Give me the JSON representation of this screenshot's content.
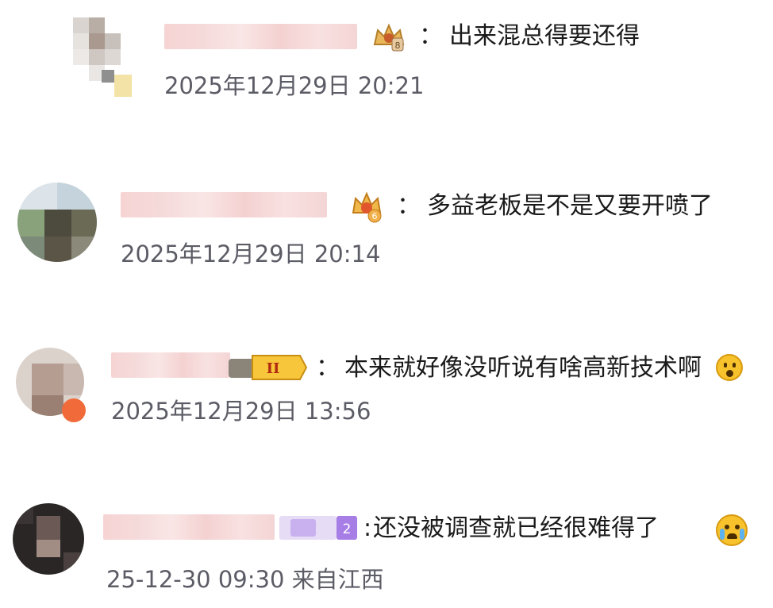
{
  "comments": [
    {
      "separator": "：",
      "text": "出来混总得要还得",
      "time": "2025年12月29日 20:21",
      "badge_level": "8"
    },
    {
      "separator": "：",
      "text": "多益老板是不是又要开喷了",
      "time": "2025年12月29日 20:14",
      "badge_level": "6"
    },
    {
      "separator": "：",
      "text": "本来就好像没听说有啥高新技术啊",
      "time": "2025年12月29日 13:56",
      "badge_level": "II"
    },
    {
      "separator": ":",
      "text": "还没被调查就已经很难得了",
      "time": "25-12-30 09:30 来自江西",
      "badge_level": "2"
    }
  ],
  "icons": [
    "crown-badge-icon",
    "crown-badge-icon",
    "rank-badge-icon",
    "member-badge-icon",
    "shocked-face-emoji-icon",
    "crying-face-emoji-icon"
  ],
  "colors": {
    "text": "#1a1a1a",
    "meta": "#5c5c66",
    "name_blur": "#f6cfcf"
  }
}
